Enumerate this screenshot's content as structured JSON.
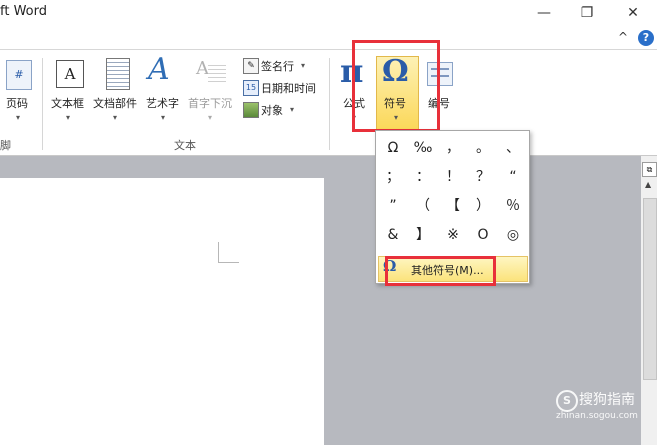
{
  "window": {
    "title": "ft Word",
    "minimize": "—",
    "restore": "❐",
    "close": "✕",
    "collapse": "^",
    "help": "?"
  },
  "ribbon": {
    "partial_left_label": "页码",
    "partial_group_label": "脚",
    "text_group": {
      "label": "文本",
      "textbox": "文本框",
      "quickparts": "文档部件",
      "wordart": "艺术字",
      "dropcap": "首字下沉",
      "signature": "签名行",
      "datetime": "日期和时间",
      "object": "对象"
    },
    "symbols_group": {
      "formula": "公式",
      "symbol": "符号",
      "number": "编号"
    }
  },
  "symbol_menu": {
    "symbols": [
      "Ω",
      "‰",
      "，",
      "。",
      "、",
      "；",
      "：",
      "！",
      "？",
      "“",
      "”",
      "（",
      "【",
      "）",
      "％",
      "&",
      "】",
      "※",
      "O",
      "◎"
    ],
    "more_symbols": "其他符号(M)..."
  },
  "watermark": {
    "brand": "搜狗指南",
    "url": "zhinan.sogou.com"
  },
  "colors": {
    "highlight_red": "#e8303a",
    "selected_button": "#fbe37c",
    "omega_blue": "#2a5ca8"
  }
}
